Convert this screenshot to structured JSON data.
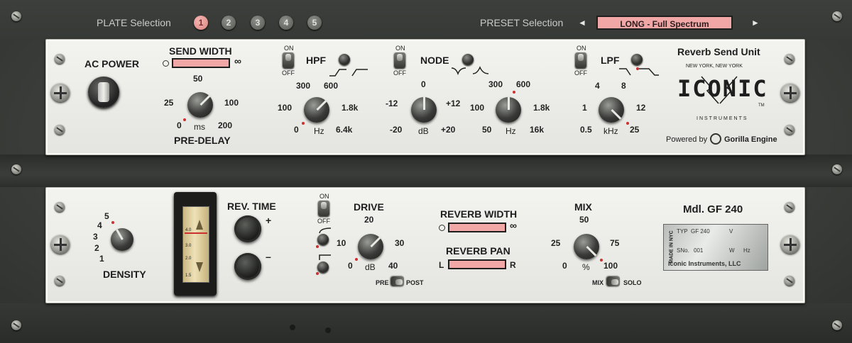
{
  "top_bar": {
    "plate_label": "PLATE Selection",
    "plates": [
      "1",
      "2",
      "3",
      "4",
      "5"
    ],
    "active_plate": "1",
    "preset_label": "PRESET Selection",
    "preset_prev": "◄",
    "preset_next": "►",
    "preset_value": "LONG - Full Spectrum"
  },
  "upper_panel": {
    "ac_power": "AC POWER",
    "send_width": "SEND WIDTH",
    "infinity": "∞",
    "predelay": {
      "title": "PRE-DELAY",
      "t0": "0",
      "t1": "25",
      "t2": "50",
      "t3": "100",
      "t4": "200",
      "unit": "ms"
    },
    "hpf": {
      "on": "ON",
      "off": "OFF",
      "title": "HPF",
      "t0": "0",
      "t1": "100",
      "t2": "300",
      "t3": "600",
      "t4": "1.8k",
      "t5": "6.4k",
      "unit": "Hz"
    },
    "node": {
      "on": "ON",
      "off": "OFF",
      "title": "NODE",
      "gain": {
        "t0": "-20",
        "t1": "-12",
        "t2": "0",
        "t3": "+12",
        "t4": "+20",
        "unit": "dB"
      },
      "freq": {
        "t0": "50",
        "t1": "100",
        "t2": "300",
        "t3": "600",
        "t4": "1.8k",
        "t5": "16k",
        "unit": "Hz"
      }
    },
    "lpf": {
      "on": "ON",
      "off": "OFF",
      "title": "LPF",
      "t0": "0.5",
      "t1": "1",
      "t2": "4",
      "t3": "8",
      "t4": "12",
      "t5": "25",
      "unit": "kHz"
    },
    "brand": {
      "subtitle": "Reverb Send Unit",
      "city": "NEW YORK, NEW YORK",
      "logo": "ICONIC",
      "instruments": "INSTRUMENTS",
      "tm": "TM",
      "powered": "Powered by",
      "engine": "Gorilla Engine"
    }
  },
  "lower_panel": {
    "density": {
      "title": "DENSITY",
      "t1": "1",
      "t2": "2",
      "t3": "3",
      "t4": "4",
      "t5": "5"
    },
    "meter": {
      "m1": "4.0",
      "m2": "3.0",
      "m3": "2.0",
      "m4": "1.5"
    },
    "rev_time": {
      "title": "REV. TIME",
      "plus": "+",
      "minus": "–"
    },
    "drive": {
      "on": "ON",
      "off": "OFF",
      "title": "DRIVE",
      "t0": "0",
      "t1": "10",
      "t2": "20",
      "t3": "30",
      "t4": "40",
      "unit": "dB",
      "pre": "PRE",
      "post": "POST"
    },
    "reverb_width": "REVERB WIDTH",
    "reverb_pan": {
      "title": "REVERB PAN",
      "l": "L",
      "r": "R"
    },
    "mix": {
      "title": "MIX",
      "t0": "0",
      "t1": "25",
      "t2": "50",
      "t3": "75",
      "t4": "100",
      "unit": "%",
      "mix": "MIX",
      "solo": "SOLO"
    },
    "model": "Mdl. GF 240",
    "tag": {
      "made": "MADE IN NYC",
      "typ": "TYP",
      "typ_val": "GF 240",
      "v": "V",
      "sn": "SNo.",
      "sn_val": "001",
      "w": "W",
      "hz": "Hz",
      "maker": "Iconic Instruments, LLC"
    }
  },
  "colors": {
    "accent": "#f2a7a7",
    "panel": "#eeeeea",
    "chassis": "#3b3e3a",
    "indicator": "#cc3030"
  }
}
